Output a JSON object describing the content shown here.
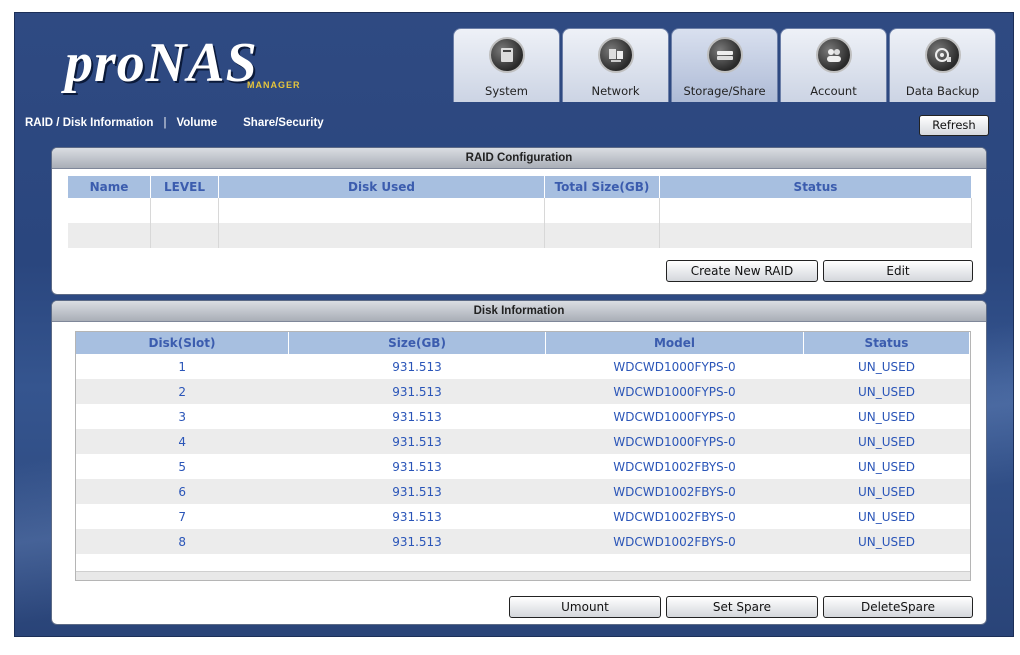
{
  "logo": {
    "text": "proNAS",
    "subtitle": "MANAGER"
  },
  "nav_tabs": [
    {
      "label": "System",
      "icon": "system-icon"
    },
    {
      "label": "Network",
      "icon": "network-icon"
    },
    {
      "label": "Storage/Share",
      "icon": "storage-icon",
      "active": true
    },
    {
      "label": "Account",
      "icon": "account-icon"
    },
    {
      "label": "Data Backup",
      "icon": "backup-icon"
    }
  ],
  "subnav": {
    "raid_disk": "RAID / Disk Information",
    "separator": "|",
    "volume": "Volume",
    "share_security": "Share/Security"
  },
  "refresh_label": "Refresh",
  "raid": {
    "title": "RAID Configuration",
    "columns": [
      "Name",
      "LEVEL",
      "Disk Used",
      "Total Size(GB)",
      "Status"
    ],
    "create_label": "Create New RAID",
    "edit_label": "Edit"
  },
  "disk": {
    "title": "Disk Information",
    "columns": [
      "Disk(Slot)",
      "Size(GB)",
      "Model",
      "Status"
    ],
    "rows": [
      {
        "slot": "1",
        "size": "931.513",
        "model": "WDCWD1000FYPS-0",
        "status": "UN_USED"
      },
      {
        "slot": "2",
        "size": "931.513",
        "model": "WDCWD1000FYPS-0",
        "status": "UN_USED"
      },
      {
        "slot": "3",
        "size": "931.513",
        "model": "WDCWD1000FYPS-0",
        "status": "UN_USED"
      },
      {
        "slot": "4",
        "size": "931.513",
        "model": "WDCWD1000FYPS-0",
        "status": "UN_USED"
      },
      {
        "slot": "5",
        "size": "931.513",
        "model": "WDCWD1002FBYS-0",
        "status": "UN_USED"
      },
      {
        "slot": "6",
        "size": "931.513",
        "model": "WDCWD1002FBYS-0",
        "status": "UN_USED"
      },
      {
        "slot": "7",
        "size": "931.513",
        "model": "WDCWD1002FBYS-0",
        "status": "UN_USED"
      },
      {
        "slot": "8",
        "size": "931.513",
        "model": "WDCWD1002FBYS-0",
        "status": "UN_USED"
      }
    ],
    "umount_label": "Umount",
    "set_spare_label": "Set Spare",
    "delete_spare_label": "DeleteSpare"
  },
  "colors": {
    "header_bg": "#2f4a82",
    "table_header": "#a7bfe0",
    "cell_text": "#2a55b8",
    "logo_accent": "#e6c53c"
  }
}
